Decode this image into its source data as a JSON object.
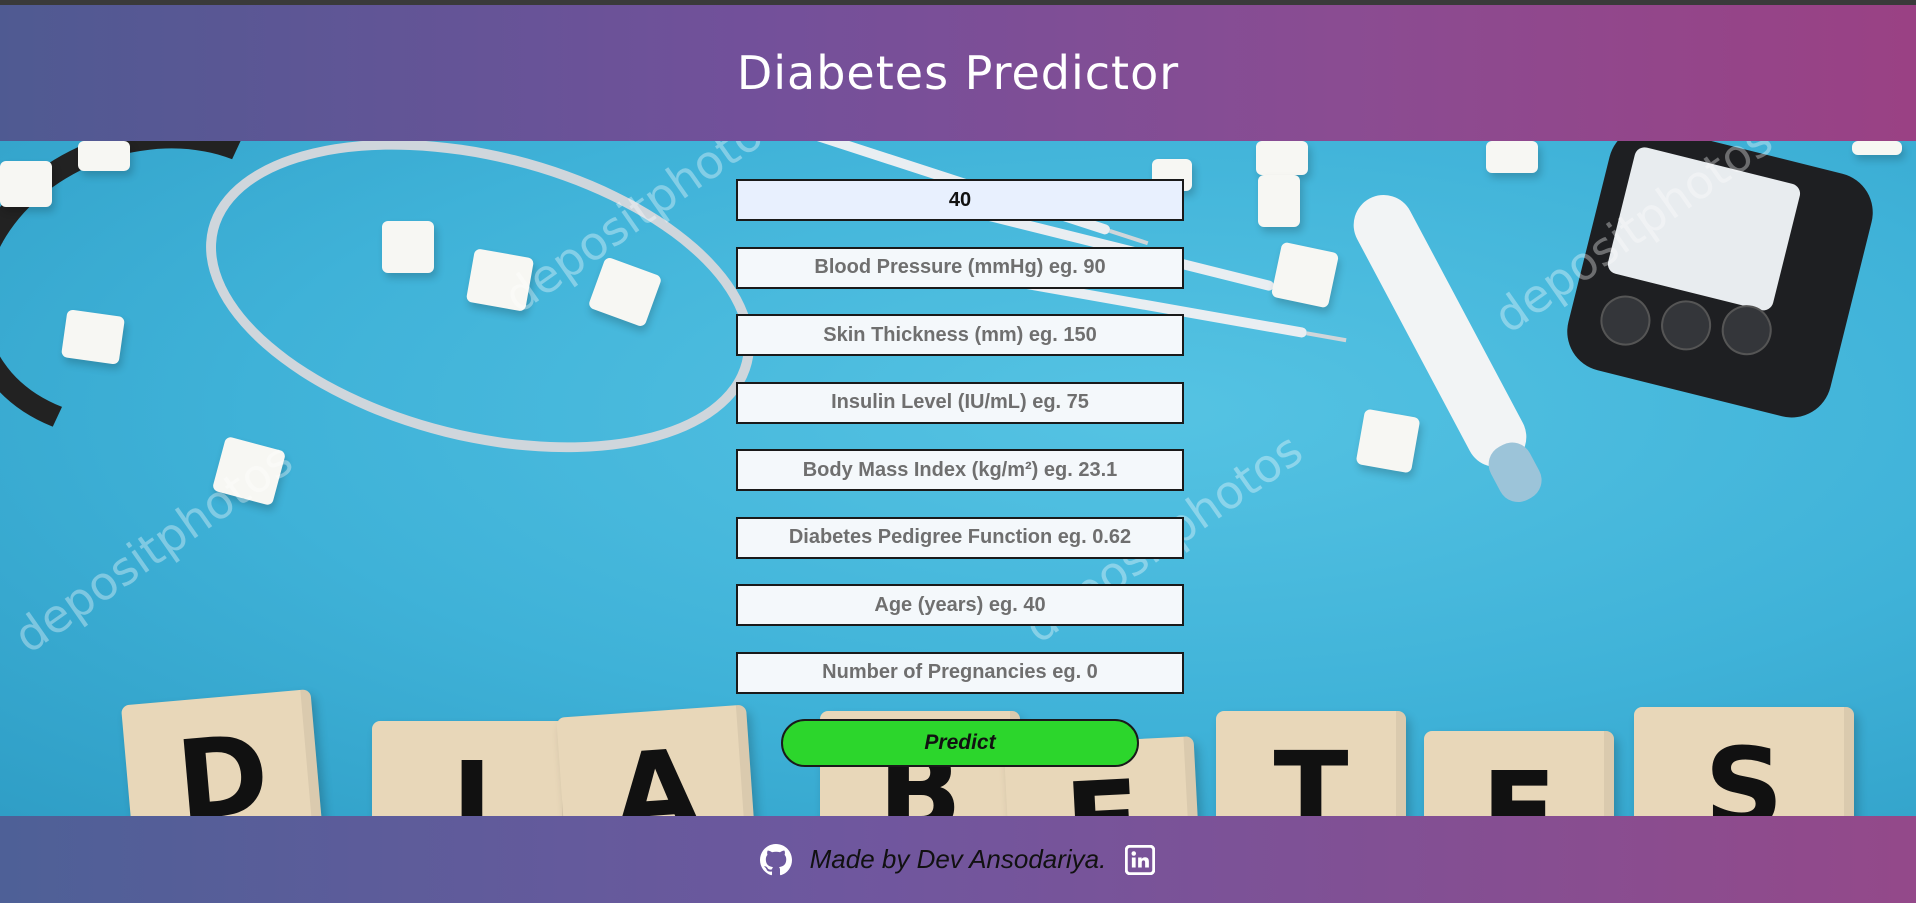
{
  "header": {
    "title": "Diabetes Predictor"
  },
  "form": {
    "fields": [
      {
        "value": "40",
        "placeholder": ""
      },
      {
        "value": "",
        "placeholder": "Blood Pressure (mmHg) eg. 90"
      },
      {
        "value": "",
        "placeholder": "Skin Thickness (mm) eg. 150"
      },
      {
        "value": "",
        "placeholder": "Insulin Level (IU/mL) eg. 75"
      },
      {
        "value": "",
        "placeholder": "Body Mass Index (kg/m²) eg. 23.1"
      },
      {
        "value": "",
        "placeholder": "Diabetes Pedigree Function eg. 0.62"
      },
      {
        "value": "",
        "placeholder": "Age (years) eg. 40"
      },
      {
        "value": "",
        "placeholder": "Number of Pregnancies eg. 0"
      }
    ],
    "submit_label": "Predict"
  },
  "background": {
    "letters": [
      "D",
      "I",
      "A",
      "B",
      "E",
      "T",
      "E",
      "S"
    ],
    "watermark": "depositphotos"
  },
  "footer": {
    "credit": "Made by Dev Ansodariya.",
    "icons": [
      "github-icon",
      "linkedin-icon"
    ]
  },
  "colors": {
    "header_gradient_start": "#4f5a92",
    "header_gradient_end": "#9a4184",
    "predict_button": "#2cd62c",
    "background": "#3fb0d6"
  }
}
